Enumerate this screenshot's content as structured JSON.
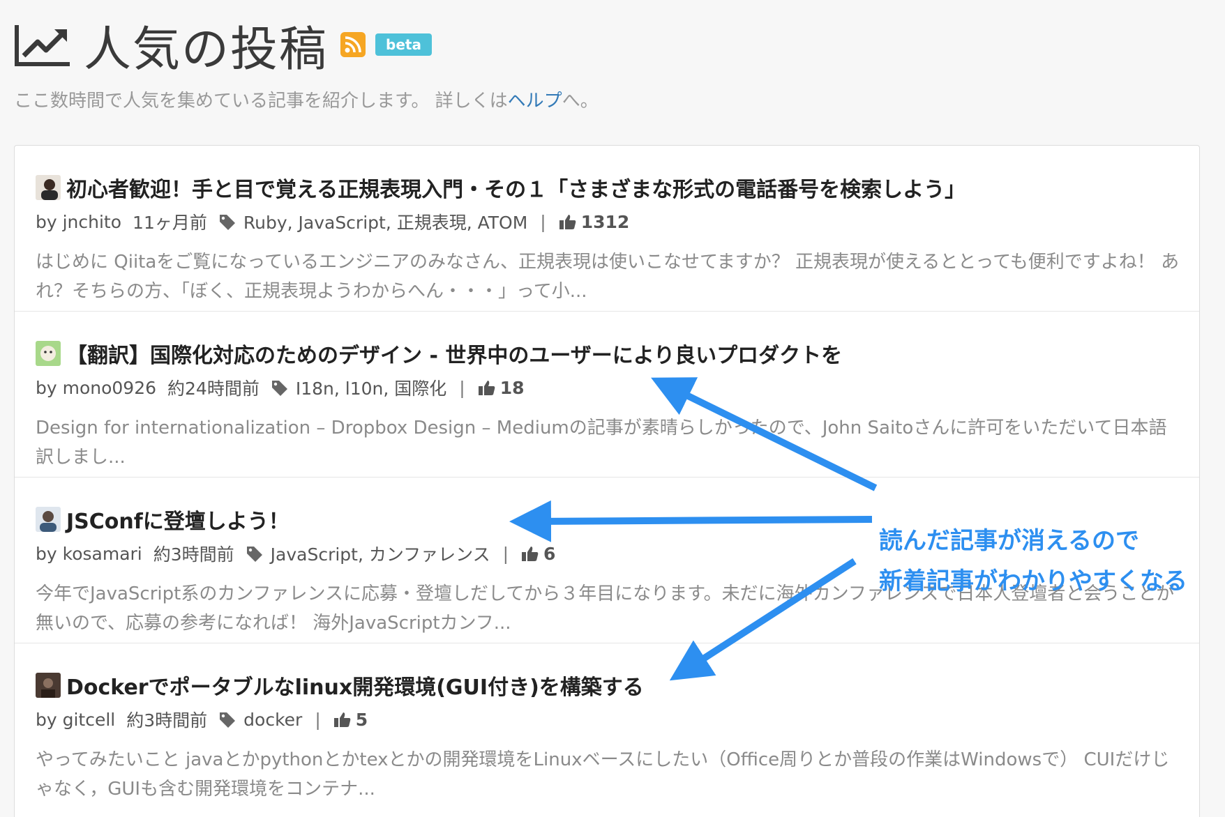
{
  "header": {
    "title": "人気の投稿",
    "beta_label": "beta",
    "subtitle_prefix": "ここ数時間で人気を集めている記事を紹介します。 詳しくは",
    "help_link": "ヘルプ",
    "subtitle_suffix": "へ。"
  },
  "items": [
    {
      "title": "初心者歓迎！手と目で覚える正規表現入門・その１「さまざまな形式の電話番号を検索しよう」",
      "author": "by jnchito",
      "time": "11ヶ月前",
      "tags": "Ruby, JavaScript, 正規表現, ATOM",
      "likes": "1312",
      "excerpt": "はじめに Qiitaをご覧になっているエンジニアのみなさん、正規表現は使いこなせてますか？ 正規表現が使えるととっても便利ですよね！ あれ？そちらの方、「ぼく、正規表現ようわからへん・・・」って小..."
    },
    {
      "title": "【翻訳】国際化対応のためのデザイン - 世界中のユーザーにより良いプロダクトを",
      "author": "by mono0926",
      "time": "約24時間前",
      "tags": "I18n, l10n, 国際化",
      "likes": "18",
      "excerpt": "Design for internationalization – Dropbox Design – Mediumの記事が素晴らしかったので、John Saitoさんに許可をいただいて日本語訳しまし..."
    },
    {
      "title": "JSConfに登壇しよう！",
      "author": "by kosamari",
      "time": "約3時間前",
      "tags": "JavaScript, カンファレンス",
      "likes": "6",
      "excerpt": "今年でJavaScript系のカンファレンスに応募・登壇しだしてから３年目になります。未だに海外カンファレンスで日本人登壇者と会うことが無いので、応募の参考になれば！ 海外JavaScriptカンフ..."
    },
    {
      "title": "Dockerでポータブルなlinux開発環境(GUI付き)を構築する",
      "author": "by gitcell",
      "time": "約3時間前",
      "tags": "docker",
      "likes": "5",
      "excerpt": "やってみたいこと javaとかpythonとかtexとかの開発環境をLinuxベースにしたい（Office周りとか普段の作業はWindowsで） CUIだけじゃなく，GUIも含む開発環境をコンテナ..."
    }
  ],
  "annotation": {
    "line1": "読んだ記事が消えるので",
    "line2": "新着記事がわかりやすくなる",
    "color": "#2d8ff0"
  },
  "colors": {
    "rss": "#f6a623",
    "beta": "#4ec1d9",
    "link": "#337ab7",
    "arrow": "#2d8ff0"
  }
}
